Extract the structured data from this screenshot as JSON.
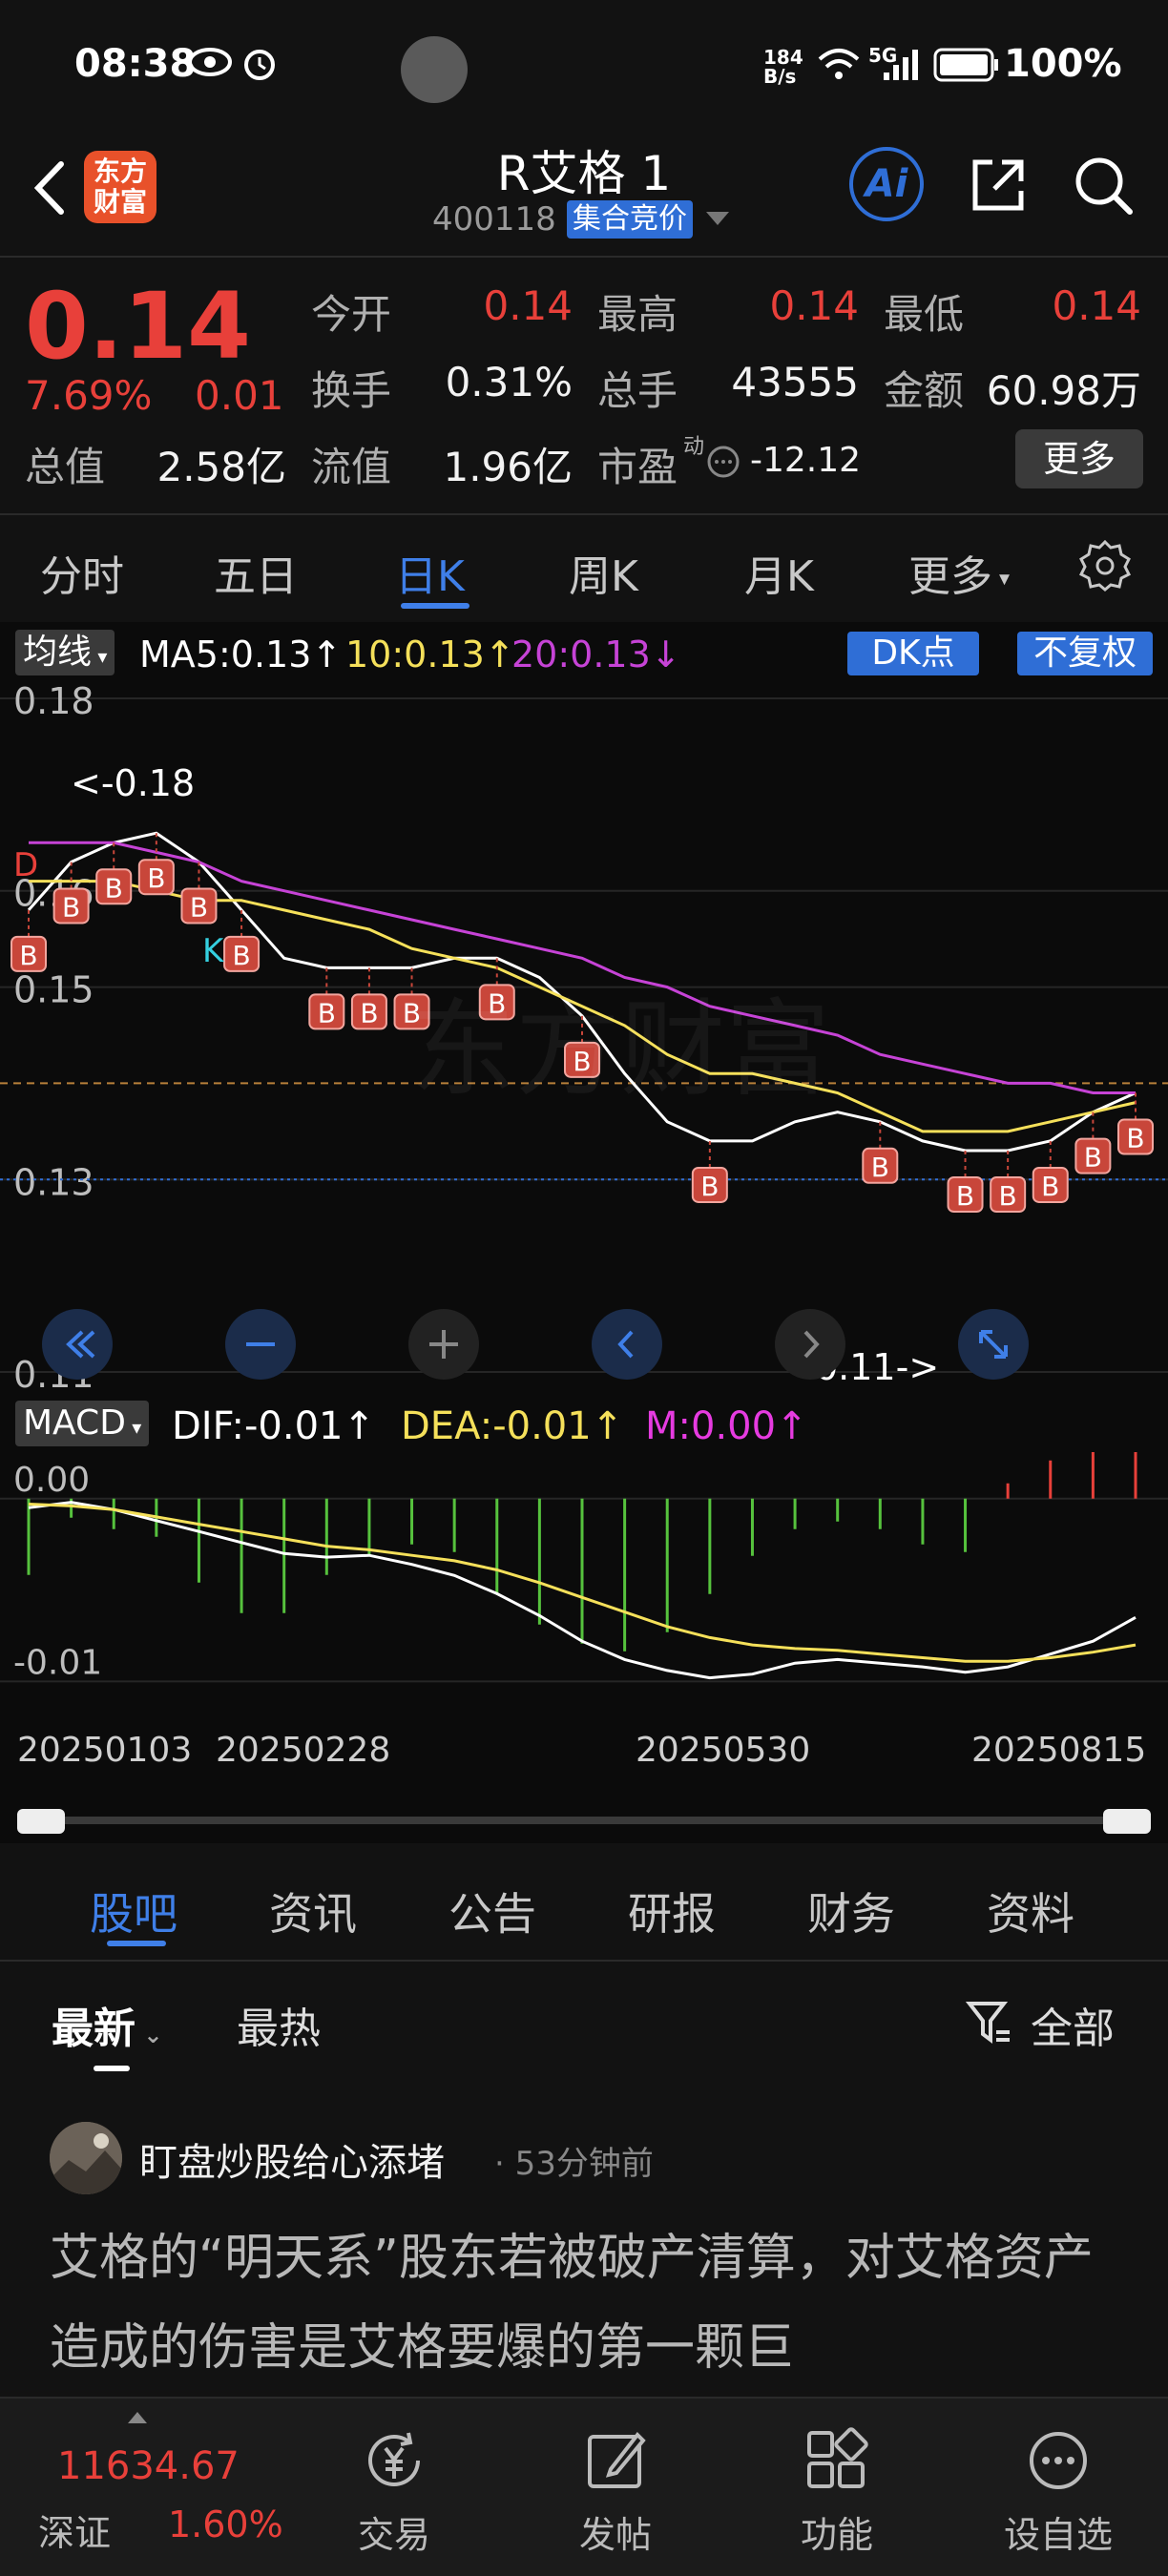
{
  "status": {
    "time": "08:38",
    "net_speed_top": "184",
    "net_speed_bottom": "B/s",
    "network": "5G",
    "battery": "100%"
  },
  "header": {
    "logo_line1": "东方",
    "logo_line2": "财富",
    "stock_name": "R艾格 1",
    "stock_code": "400118",
    "auction_badge": "集合竞价",
    "ai_label": "Ai"
  },
  "quote": {
    "price": "0.14",
    "change_pct": "7.69%",
    "change": "0.01",
    "open_label": "今开",
    "open": "0.14",
    "high_label": "最高",
    "high": "0.14",
    "low_label": "最低",
    "low": "0.14",
    "turnover_label": "换手",
    "turnover": "0.31%",
    "volume_label": "总手",
    "volume": "43555",
    "amount_label": "金额",
    "amount": "60.98万",
    "mktcap_label": "总值",
    "mktcap": "2.58亿",
    "float_label": "流值",
    "float_cap": "1.96亿",
    "pe_label": "市盈",
    "pe_sup": "动",
    "pe": "-12.12",
    "more": "更多"
  },
  "period_tabs": [
    "分时",
    "五日",
    "日K",
    "周K",
    "月K",
    "更多"
  ],
  "ma_bar": {
    "select": "均线",
    "ma5": "MA5:0.13↑",
    "ma10": "10:0.13↑",
    "ma20": "20:0.13↓",
    "dk": "DK点",
    "fq": "不复权",
    "colors": {
      "ma5": "#ffffff",
      "ma10": "#f5e05a",
      "ma20": "#c643d6"
    }
  },
  "macd_bar": {
    "select": "MACD",
    "dif": "DIF:-0.01↑",
    "dea": "DEA:-0.01↑",
    "m": "M:0.00↑"
  },
  "chart_data": {
    "type": "line",
    "title": "",
    "price_axis": {
      "ticks": [
        "0.18",
        "0.16",
        "0.15",
        "0.13",
        "0.11"
      ],
      "ylim": [
        0.11,
        0.18
      ]
    },
    "annotations": {
      "high_marker": "<-0.18",
      "low_marker": "0.11->",
      "d_marker": "D",
      "k_marker": "K",
      "signal_label": "B"
    },
    "series": [
      {
        "name": "MA5",
        "values": [
          0.158,
          0.163,
          0.165,
          0.166,
          0.163,
          0.158,
          0.153,
          0.152,
          0.152,
          0.152,
          0.153,
          0.153,
          0.151,
          0.147,
          0.141,
          0.136,
          0.134,
          0.134,
          0.136,
          0.137,
          0.136,
          0.134,
          0.133,
          0.133,
          0.134,
          0.137,
          0.139
        ]
      },
      {
        "name": "10",
        "values": [
          0.161,
          0.161,
          0.161,
          0.16,
          0.159,
          0.159,
          0.158,
          0.157,
          0.156,
          0.154,
          0.153,
          0.152,
          0.15,
          0.148,
          0.146,
          0.143,
          0.141,
          0.141,
          0.14,
          0.139,
          0.137,
          0.135,
          0.135,
          0.135,
          0.136,
          0.137,
          0.138
        ]
      },
      {
        "name": "20",
        "values": [
          0.165,
          0.165,
          0.165,
          0.164,
          0.163,
          0.161,
          0.16,
          0.159,
          0.158,
          0.157,
          0.156,
          0.155,
          0.154,
          0.153,
          0.151,
          0.15,
          0.148,
          0.147,
          0.146,
          0.145,
          0.143,
          0.142,
          0.141,
          0.14,
          0.14,
          0.139,
          0.139
        ]
      }
    ],
    "macd": {
      "ticks": [
        "0.00",
        "-0.01"
      ],
      "dif": [
        -0.0005,
        -0.0002,
        -0.0006,
        -0.0012,
        -0.0018,
        -0.0024,
        -0.003,
        -0.0032,
        -0.0031,
        -0.0036,
        -0.0042,
        -0.0052,
        -0.0064,
        -0.0078,
        -0.0088,
        -0.0094,
        -0.0098,
        -0.0096,
        -0.009,
        -0.0088,
        -0.009,
        -0.0092,
        -0.0095,
        -0.0092,
        -0.0085,
        -0.0078,
        -0.0065
      ],
      "dea": [
        -0.0003,
        -0.0004,
        -0.0006,
        -0.001,
        -0.0014,
        -0.0018,
        -0.0022,
        -0.0026,
        -0.0028,
        -0.0031,
        -0.0034,
        -0.0039,
        -0.0046,
        -0.0054,
        -0.0062,
        -0.007,
        -0.0076,
        -0.008,
        -0.0082,
        -0.0083,
        -0.0085,
        -0.0087,
        -0.0089,
        -0.0089,
        -0.0087,
        -0.0084,
        -0.008
      ],
      "hist": [
        -0.002,
        -0.0005,
        -0.0008,
        -0.001,
        -0.0022,
        -0.003,
        -0.003,
        -0.002,
        -0.0015,
        -0.0012,
        -0.0014,
        -0.0025,
        -0.0033,
        -0.0038,
        -0.004,
        -0.0035,
        -0.0025,
        -0.0015,
        -0.0008,
        -0.0006,
        -0.0008,
        -0.0012,
        -0.0014,
        0.0004,
        0.001,
        0.0016,
        0.0028
      ]
    },
    "dates": [
      "20250103",
      "20250228",
      "20250530",
      "20250815"
    ]
  },
  "content_tabs": [
    "股吧",
    "资讯",
    "公告",
    "研报",
    "财务",
    "资料"
  ],
  "feed": {
    "sort_latest": "最新",
    "sort_hot": "最热",
    "filter": "全部"
  },
  "post": {
    "user": "盯盘炒股给心添堵",
    "time": "· 53分钟前",
    "body": "艾格的“明天系”股东若被破产清算，对艾格资产造成的伤害是艾格要爆的第一颗巨"
  },
  "bottom_nav": {
    "index_value": "11634.67",
    "index_name": "深证",
    "index_pct": "1.60%",
    "items": [
      "交易",
      "发帖",
      "功能",
      "设自选"
    ]
  }
}
